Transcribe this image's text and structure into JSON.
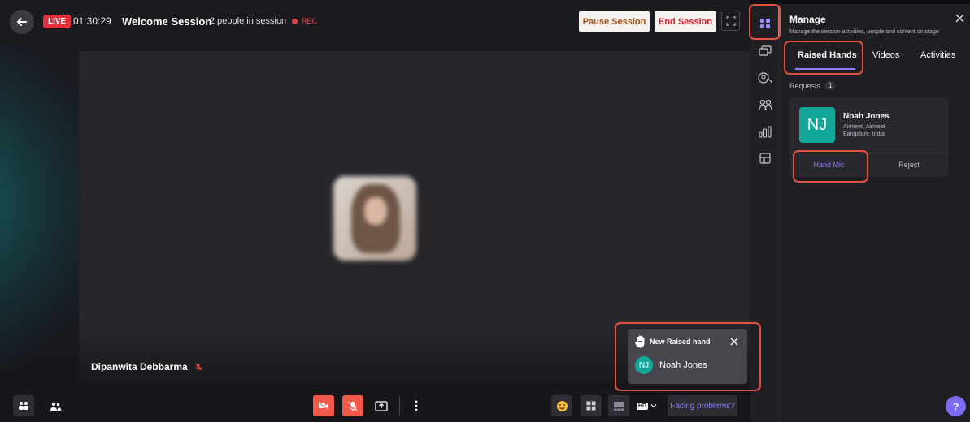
{
  "header": {
    "live_label": "LIVE",
    "timer": "01:30:29",
    "session_title": "Welcome Session",
    "people_count": "2 people in session",
    "rec_label": "REC",
    "pause_label": "Pause Session",
    "end_label": "End Session"
  },
  "stage": {
    "speaker_name": "Dipanwita Debbarma"
  },
  "notification": {
    "title": "New Raised hand",
    "avatar_initials": "NJ",
    "name": "Noah Jones"
  },
  "toolbar": {
    "hd_label": "HD",
    "facing_problems": "Facing problems?"
  },
  "panel": {
    "title": "Manage",
    "subtitle": "Manage the session activities, people and content on stage",
    "tabs": [
      {
        "label": "Raised Hands",
        "active": true
      },
      {
        "label": "Videos",
        "active": false
      },
      {
        "label": "Activities",
        "active": false
      }
    ],
    "requests_label": "Requests",
    "requests_count": "1",
    "request": {
      "initials": "NJ",
      "name": "Noah Jones",
      "company": "Airmeet, Airmeet",
      "location": "Bangalore, India",
      "hand_mic_label": "Hand Mic",
      "reject_label": "Reject"
    }
  },
  "help": {
    "label": "?"
  },
  "colors": {
    "accent": "#8c7cff",
    "live": "#e0303d",
    "highlight": "#e4513f",
    "avatar": "#13a79a",
    "danger_button": "#f0584a"
  }
}
